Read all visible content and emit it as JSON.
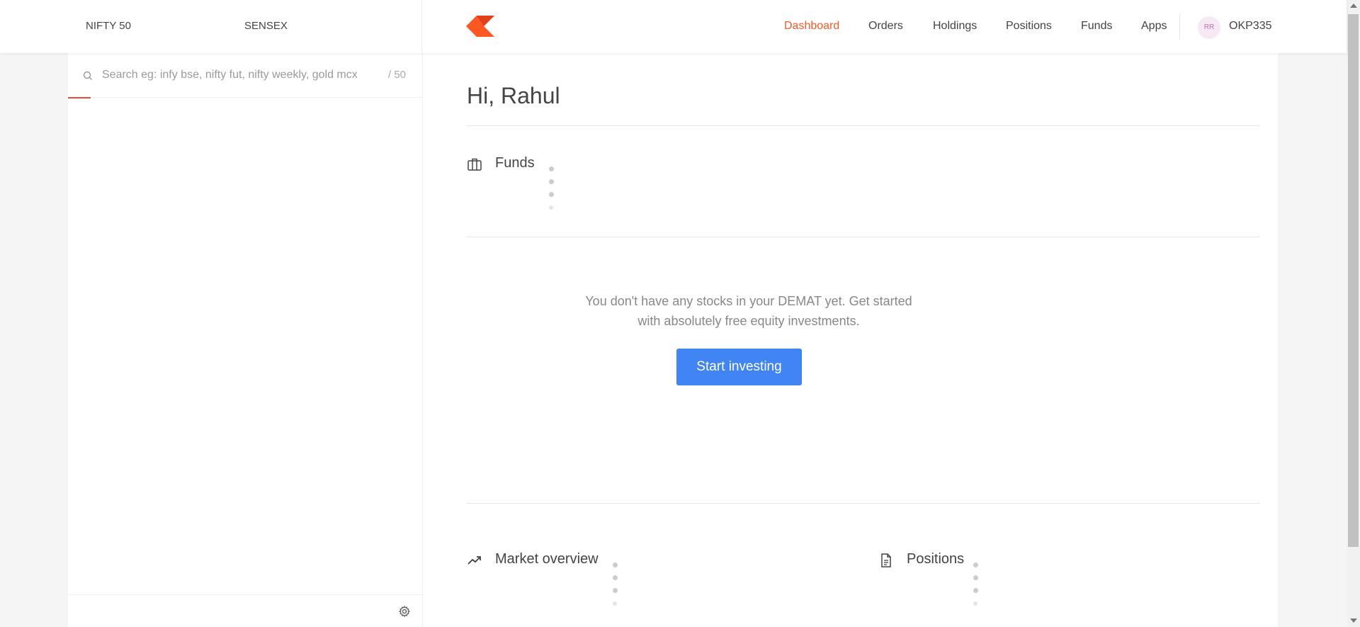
{
  "header": {
    "indices": [
      {
        "label": "NIFTY 50"
      },
      {
        "label": "SENSEX"
      }
    ],
    "logo_icon": "kite-logo-icon",
    "brand_color": "#ff5722",
    "nav": [
      {
        "label": "Dashboard",
        "active": true
      },
      {
        "label": "Orders",
        "active": false
      },
      {
        "label": "Holdings",
        "active": false
      },
      {
        "label": "Positions",
        "active": false
      },
      {
        "label": "Funds",
        "active": false
      },
      {
        "label": "Apps",
        "active": false
      }
    ],
    "avatar_initials": "RR",
    "user_id": "OKP335"
  },
  "sidebar": {
    "search": {
      "placeholder": "Search eg: infy bse, nifty fut, nifty weekly, gold mcx",
      "value": "",
      "count": "/ 50"
    },
    "footer_icon": "gear-icon"
  },
  "main": {
    "greeting": "Hi, Rahul",
    "funds": {
      "label": "Funds",
      "icon": "briefcase-icon"
    },
    "holdings_empty": {
      "line1": "You don't have any stocks in your DEMAT yet. Get started",
      "line2": "with absolutely free equity investments.",
      "button": "Start investing",
      "button_color": "#4184f3"
    },
    "market_overview": {
      "label": "Market overview",
      "icon": "trending-up-icon"
    },
    "positions": {
      "label": "Positions",
      "icon": "document-icon"
    }
  }
}
